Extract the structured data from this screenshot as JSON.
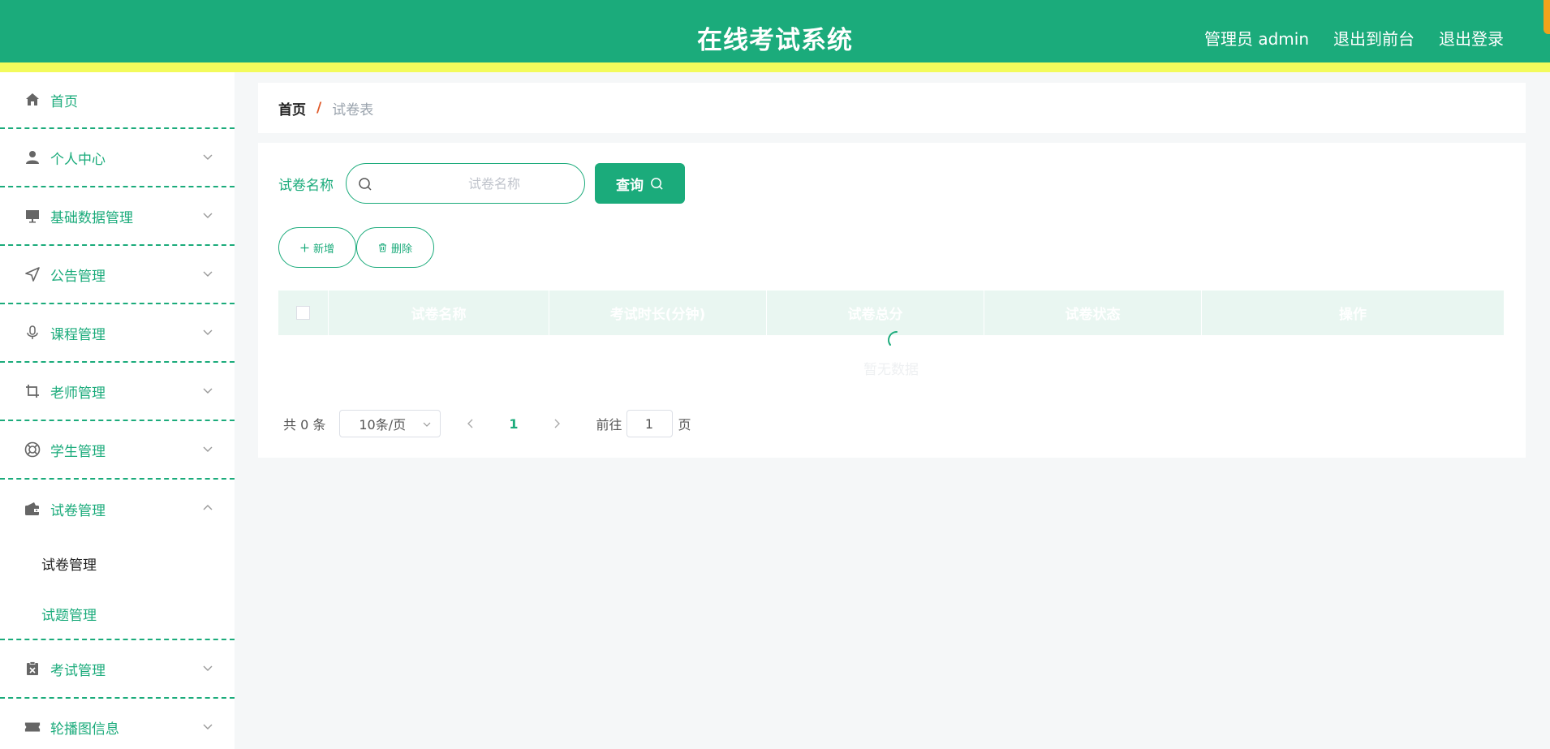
{
  "app": {
    "title": "在线考试系统",
    "user_label": "管理员 admin",
    "to_front_label": "退出到前台",
    "logout_label": "退出登录"
  },
  "colors": {
    "primary": "#1bab7b",
    "accent_bar": "#f3fb5c",
    "breadcrumb_sep": "#e05a2a"
  },
  "sidebar": {
    "items": [
      {
        "label": "首页",
        "icon": "home-icon"
      },
      {
        "label": "个人中心",
        "icon": "user-icon"
      },
      {
        "label": "基础数据管理",
        "icon": "monitor-icon"
      },
      {
        "label": "公告管理",
        "icon": "send-icon"
      },
      {
        "label": "课程管理",
        "icon": "microphone-icon"
      },
      {
        "label": "老师管理",
        "icon": "crop-icon"
      },
      {
        "label": "学生管理",
        "icon": "lifebuoy-icon"
      }
    ],
    "open_group": {
      "label": "试卷管理",
      "icon": "wallet-icon",
      "children": [
        "试卷管理",
        "试题管理"
      ]
    },
    "items_after": [
      {
        "label": "考试管理",
        "icon": "clipboard-x-icon"
      },
      {
        "label": "轮播图信息",
        "icon": "ticket-icon"
      }
    ]
  },
  "breadcrumb": {
    "home": "首页",
    "separator": "/",
    "current": "试卷表"
  },
  "search": {
    "label": "试卷名称",
    "placeholder": "试卷名称",
    "query_label": "查询"
  },
  "actions": {
    "add_label": "新增",
    "delete_label": "删除"
  },
  "table": {
    "columns": [
      "试卷名称",
      "考试时长(分钟)",
      "试卷总分",
      "试卷状态",
      "操作"
    ],
    "empty_text": "暂无数据"
  },
  "pagination": {
    "total_text": "共 0 条",
    "page_size": "10条/页",
    "current_page": "1",
    "goto_label": "前往",
    "goto_value": "1",
    "page_unit": "页"
  }
}
